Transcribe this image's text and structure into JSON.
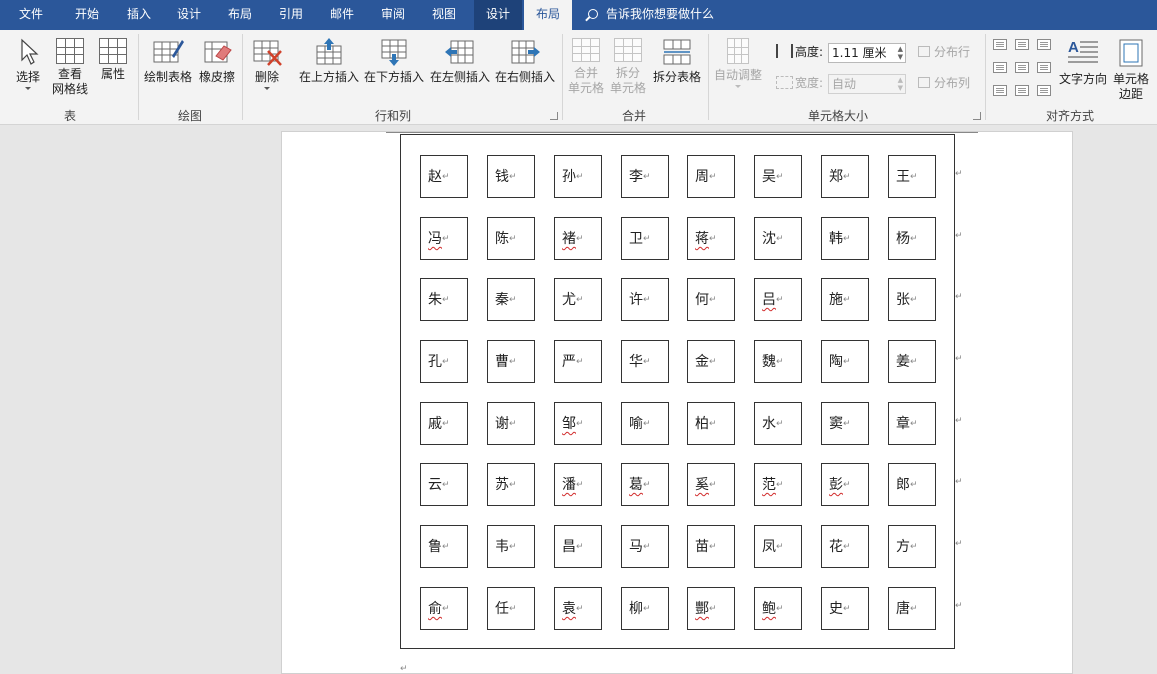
{
  "tabs": [
    "文件",
    "开始",
    "插入",
    "设计",
    "布局",
    "引用",
    "邮件",
    "审阅",
    "视图",
    "设计",
    "布局"
  ],
  "tell_me": "告诉我你想要做什么",
  "ribbon": {
    "group_table": {
      "label": "表",
      "select": "选择",
      "view_grid_1": "查看",
      "view_grid_2": "网格线",
      "properties": "属性"
    },
    "group_draw": {
      "label": "绘图",
      "draw_table": "绘制表格",
      "eraser": "橡皮擦"
    },
    "group_rows_cols": {
      "label": "行和列",
      "delete": "删除",
      "insert_above": "在上方插入",
      "insert_below": "在下方插入",
      "insert_left": "在左侧插入",
      "insert_right": "在右侧插入"
    },
    "group_merge": {
      "label": "合并",
      "merge_cells_1": "合并",
      "merge_cells_2": "单元格",
      "split_cells_1": "拆分",
      "split_cells_2": "单元格",
      "split_table": "拆分表格"
    },
    "group_cell_size": {
      "label": "单元格大小",
      "autofit": "自动调整",
      "height_label": "高度:",
      "height_value": "1.11 厘米",
      "width_label": "宽度:",
      "width_value": "自动",
      "distribute_rows": "分布行",
      "distribute_cols": "分布列"
    },
    "group_alignment": {
      "label": "对齐方式",
      "text_direction": "文字方向",
      "cell_margins_1": "单元格",
      "cell_margins_2": "边距"
    }
  },
  "surnames": [
    [
      {
        "t": "赵"
      },
      {
        "t": "钱"
      },
      {
        "t": "孙"
      },
      {
        "t": "李"
      },
      {
        "t": "周"
      },
      {
        "t": "吴"
      },
      {
        "t": "郑"
      },
      {
        "t": "王"
      }
    ],
    [
      {
        "t": "冯",
        "s": true
      },
      {
        "t": "陈"
      },
      {
        "t": "褚",
        "s": true
      },
      {
        "t": "卫"
      },
      {
        "t": "蒋",
        "s": true
      },
      {
        "t": "沈"
      },
      {
        "t": "韩"
      },
      {
        "t": "杨"
      }
    ],
    [
      {
        "t": "朱"
      },
      {
        "t": "秦"
      },
      {
        "t": "尤"
      },
      {
        "t": "许"
      },
      {
        "t": "何"
      },
      {
        "t": "吕",
        "s": true
      },
      {
        "t": "施"
      },
      {
        "t": "张"
      }
    ],
    [
      {
        "t": "孔"
      },
      {
        "t": "曹"
      },
      {
        "t": "严"
      },
      {
        "t": "华"
      },
      {
        "t": "金"
      },
      {
        "t": "魏"
      },
      {
        "t": "陶"
      },
      {
        "t": "姜"
      }
    ],
    [
      {
        "t": "戚"
      },
      {
        "t": "谢"
      },
      {
        "t": "邹",
        "s": true
      },
      {
        "t": "喻"
      },
      {
        "t": "柏"
      },
      {
        "t": "水"
      },
      {
        "t": "窦"
      },
      {
        "t": "章"
      }
    ],
    [
      {
        "t": "云"
      },
      {
        "t": "苏"
      },
      {
        "t": "潘",
        "s": true
      },
      {
        "t": "葛",
        "s": true
      },
      {
        "t": "奚",
        "s": true
      },
      {
        "t": "范",
        "s": true
      },
      {
        "t": "彭",
        "s": true
      },
      {
        "t": "郎"
      }
    ],
    [
      {
        "t": "鲁"
      },
      {
        "t": "韦"
      },
      {
        "t": "昌"
      },
      {
        "t": "马"
      },
      {
        "t": "苗"
      },
      {
        "t": "凤"
      },
      {
        "t": "花"
      },
      {
        "t": "方"
      }
    ],
    [
      {
        "t": "俞",
        "s": true
      },
      {
        "t": "任"
      },
      {
        "t": "袁",
        "s": true
      },
      {
        "t": "柳"
      },
      {
        "t": "酆",
        "s": true
      },
      {
        "t": "鲍",
        "s": true
      },
      {
        "t": "史"
      },
      {
        "t": "唐"
      }
    ]
  ]
}
